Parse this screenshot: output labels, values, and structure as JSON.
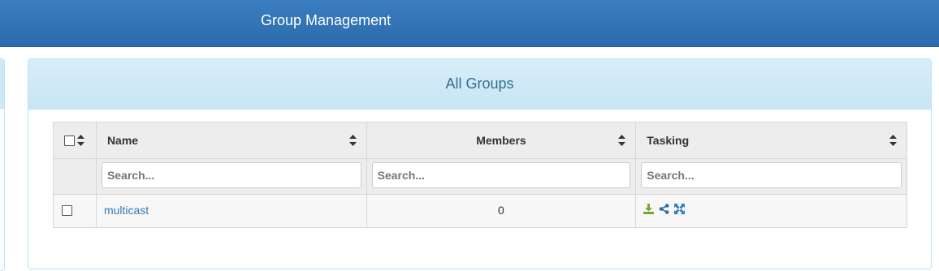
{
  "header": {
    "title": "Group Management"
  },
  "panel": {
    "title": "All Groups"
  },
  "table": {
    "columns": [
      {
        "key": "name",
        "label": "Name"
      },
      {
        "key": "members",
        "label": "Members"
      },
      {
        "key": "tasking",
        "label": "Tasking"
      }
    ],
    "search_placeholders": [
      "Search...",
      "Search...",
      "Search..."
    ],
    "rows": [
      {
        "name": "multicast",
        "members": "0",
        "tasking_icons": [
          "download-icon",
          "share-icon",
          "expand-icon"
        ]
      }
    ]
  },
  "colors": {
    "topbar": "#2f72b4",
    "panel_header": "#cde8f6",
    "link": "#337ab7",
    "download_icon": "#7aa52b",
    "share_icon": "#2f6fa8",
    "expand_icon": "#2f7fc1"
  }
}
